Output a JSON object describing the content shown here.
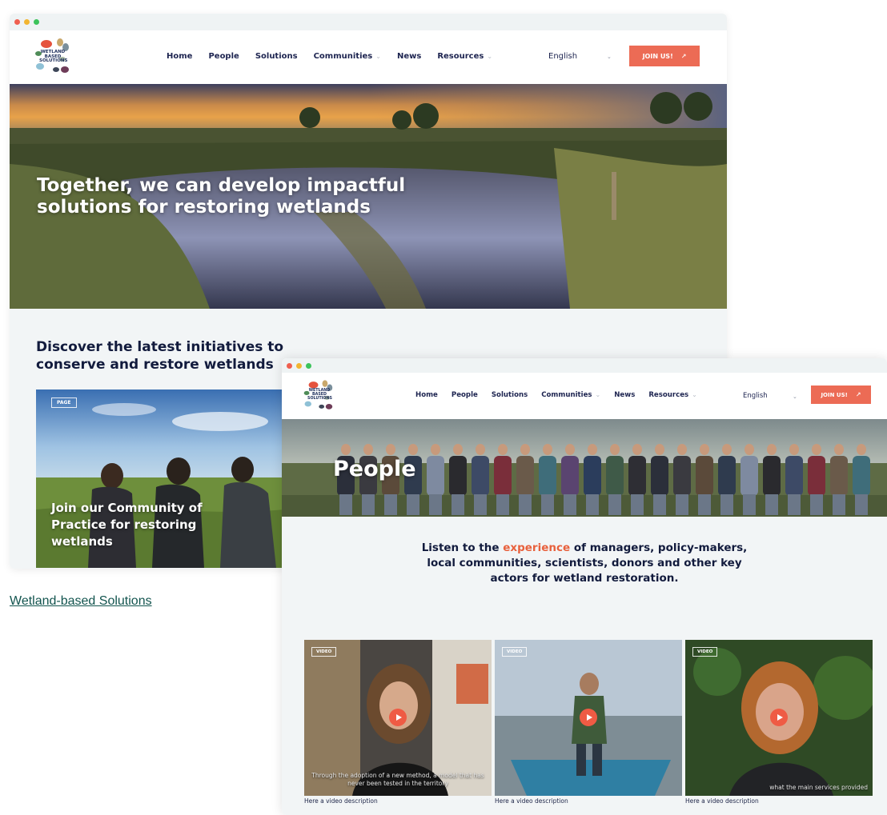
{
  "site": {
    "logo_text": "WETLAND BASED SOLUTIONS",
    "nav": [
      "Home",
      "People",
      "Solutions",
      "Communities",
      "News",
      "Resources"
    ],
    "language": "English",
    "join_label": "JOIN US!",
    "colors": {
      "brand": "#ec6b55",
      "navy": "#1d2450",
      "link": "#12544e"
    }
  },
  "home_page": {
    "hero_title": "Together, we can develop impactful solutions for restoring wetlands",
    "section_title": "Discover the latest initiatives to conserve and restore wetlands",
    "card": {
      "badge": "PAGE",
      "title": "Join our Community of Practice for restoring wetlands"
    }
  },
  "caption_link": "Wetland-based Solutions",
  "people_page": {
    "hero_title": "People",
    "intro_before": "Listen to the ",
    "intro_accent": "experience",
    "intro_after": " of managers, policy-makers, local communities, scientists, donors and other key actors for wetland restoration.",
    "videos": [
      {
        "badge": "VIDEO",
        "subtitle": "Through the adoption of a new method, a model that has never been tested in the territory",
        "description": "Here a video description"
      },
      {
        "badge": "VIDEO",
        "subtitle": "",
        "description": "Here a video description"
      },
      {
        "badge": "VIDEO",
        "subtitle": "what the main services provided",
        "description": "Here a video description"
      }
    ]
  }
}
